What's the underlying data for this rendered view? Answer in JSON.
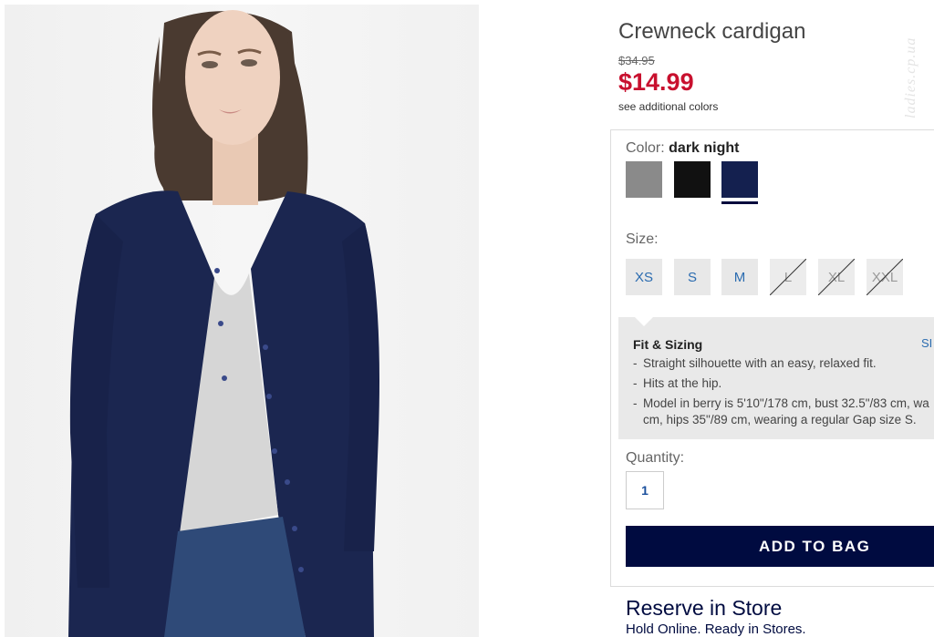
{
  "product": {
    "title": "Crewneck cardigan",
    "original_price": "$34.95",
    "sale_price": "$14.99",
    "colors_link": "see additional colors",
    "watermark": "ladies.cp.ua"
  },
  "color": {
    "label": "Color:",
    "selected": "dark night",
    "swatches": [
      {
        "name": "gray",
        "hex": "#8a8a8a"
      },
      {
        "name": "black",
        "hex": "#111111"
      },
      {
        "name": "dark night",
        "hex": "#14204f",
        "selected": true
      }
    ]
  },
  "size": {
    "label": "Size:",
    "options": [
      {
        "label": "XS",
        "available": true
      },
      {
        "label": "S",
        "available": true
      },
      {
        "label": "M",
        "available": true
      },
      {
        "label": "L",
        "available": false
      },
      {
        "label": "XL",
        "available": false
      },
      {
        "label": "XXL",
        "available": false
      }
    ]
  },
  "fit": {
    "title": "Fit & Sizing",
    "size_chart_link": "SI",
    "items": [
      "Straight silhouette with an easy, relaxed fit.",
      "Hits at the hip."
    ],
    "model_line1": "Model in berry is 5'10\"/178 cm, bust 32.5\"/83 cm, wa",
    "model_line2": "cm, hips 35\"/89 cm, wearing a regular Gap size S."
  },
  "quantity": {
    "label": "Quantity:",
    "value": "1"
  },
  "cart": {
    "add_label": "ADD TO BAG"
  },
  "reserve": {
    "title": "Reserve in Store",
    "subtitle": "Hold Online. Ready in Stores."
  }
}
